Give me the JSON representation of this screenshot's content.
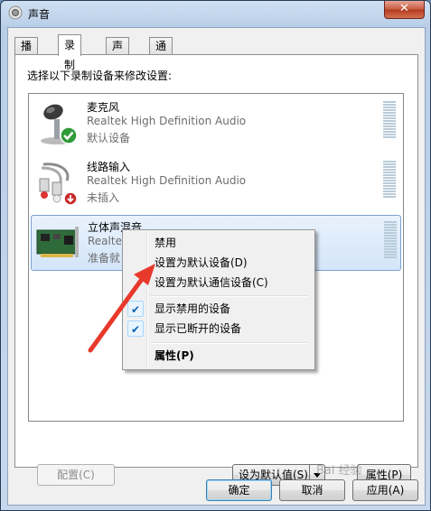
{
  "window": {
    "title": "声音",
    "close_symbol": "✕"
  },
  "tabs": [
    {
      "label": "播放",
      "active": false
    },
    {
      "label": "录制",
      "active": true
    },
    {
      "label": "声音",
      "active": false
    },
    {
      "label": "通信",
      "active": false
    }
  ],
  "panel": {
    "instruction": "选择以下录制设备来修改设置:"
  },
  "devices": [
    {
      "name": "麦克风",
      "driver": "Realtek High Definition Audio",
      "status": "默认设备",
      "icon": "microphone-icon",
      "badge": "default-check-icon"
    },
    {
      "name": "线路输入",
      "driver": "Realtek High Definition Audio",
      "status": "未插入",
      "icon": "line-in-cable-icon",
      "badge": "unplugged-arrow-icon"
    },
    {
      "name": "立体声混音",
      "driver": "Realtek",
      "status": "准备就",
      "icon": "sound-card-icon",
      "selected": true
    }
  ],
  "buttons": {
    "configure": "配置(C)",
    "set_default": "设为默认值(S)",
    "properties": "属性(P)",
    "ok": "确定",
    "cancel": "取消",
    "apply": "应用(A)"
  },
  "context_menu": {
    "disable": "禁用",
    "set_default_device": "设置为默认设备(D)",
    "set_default_comm": "设置为默认通信设备(C)",
    "show_disabled": "显示禁用的设备",
    "show_disconnected": "显示已断开的设备",
    "properties": "属性(P)",
    "show_disabled_checked": true,
    "show_disconnected_checked": true
  },
  "annotation": {
    "arrow_color": "#e8392b"
  },
  "colors": {
    "selection": "#d3e5fa",
    "check": "#0c61b5",
    "close_button": "#c75a3f"
  },
  "watermark": {
    "text": "Bai 经验"
  }
}
